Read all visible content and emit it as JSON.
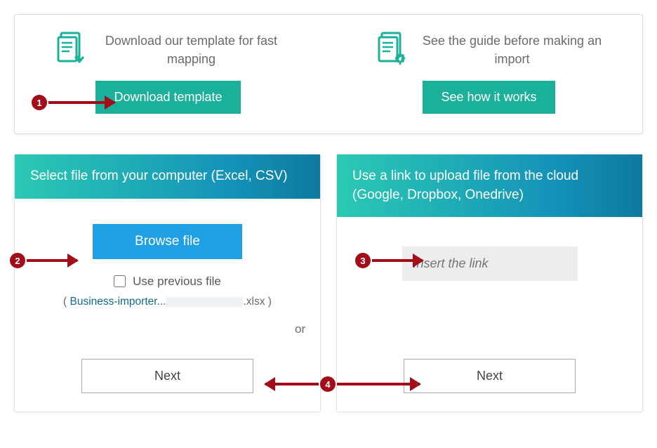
{
  "top": {
    "left_text": "Download our template for fast mapping",
    "left_button": "Download template",
    "right_text": "See the guide before making an import",
    "right_button": "See how it works"
  },
  "left_panel": {
    "header": "Select file from your computer (Excel, CSV)",
    "browse_button": "Browse file",
    "use_previous_label": "Use previous file",
    "prev_open": "( ",
    "prev_link_text": "Business-importer...",
    "prev_ext": ".xlsx",
    "prev_close": " )",
    "next_button": "Next"
  },
  "right_panel": {
    "header": "Use a link to upload file from the cloud (Google, Dropbox, Onedrive)",
    "or_label": "or",
    "input_placeholder": "Insert the link",
    "next_button": "Next"
  },
  "markers": {
    "m1": "1",
    "m2": "2",
    "m3": "3",
    "m4": "4"
  }
}
